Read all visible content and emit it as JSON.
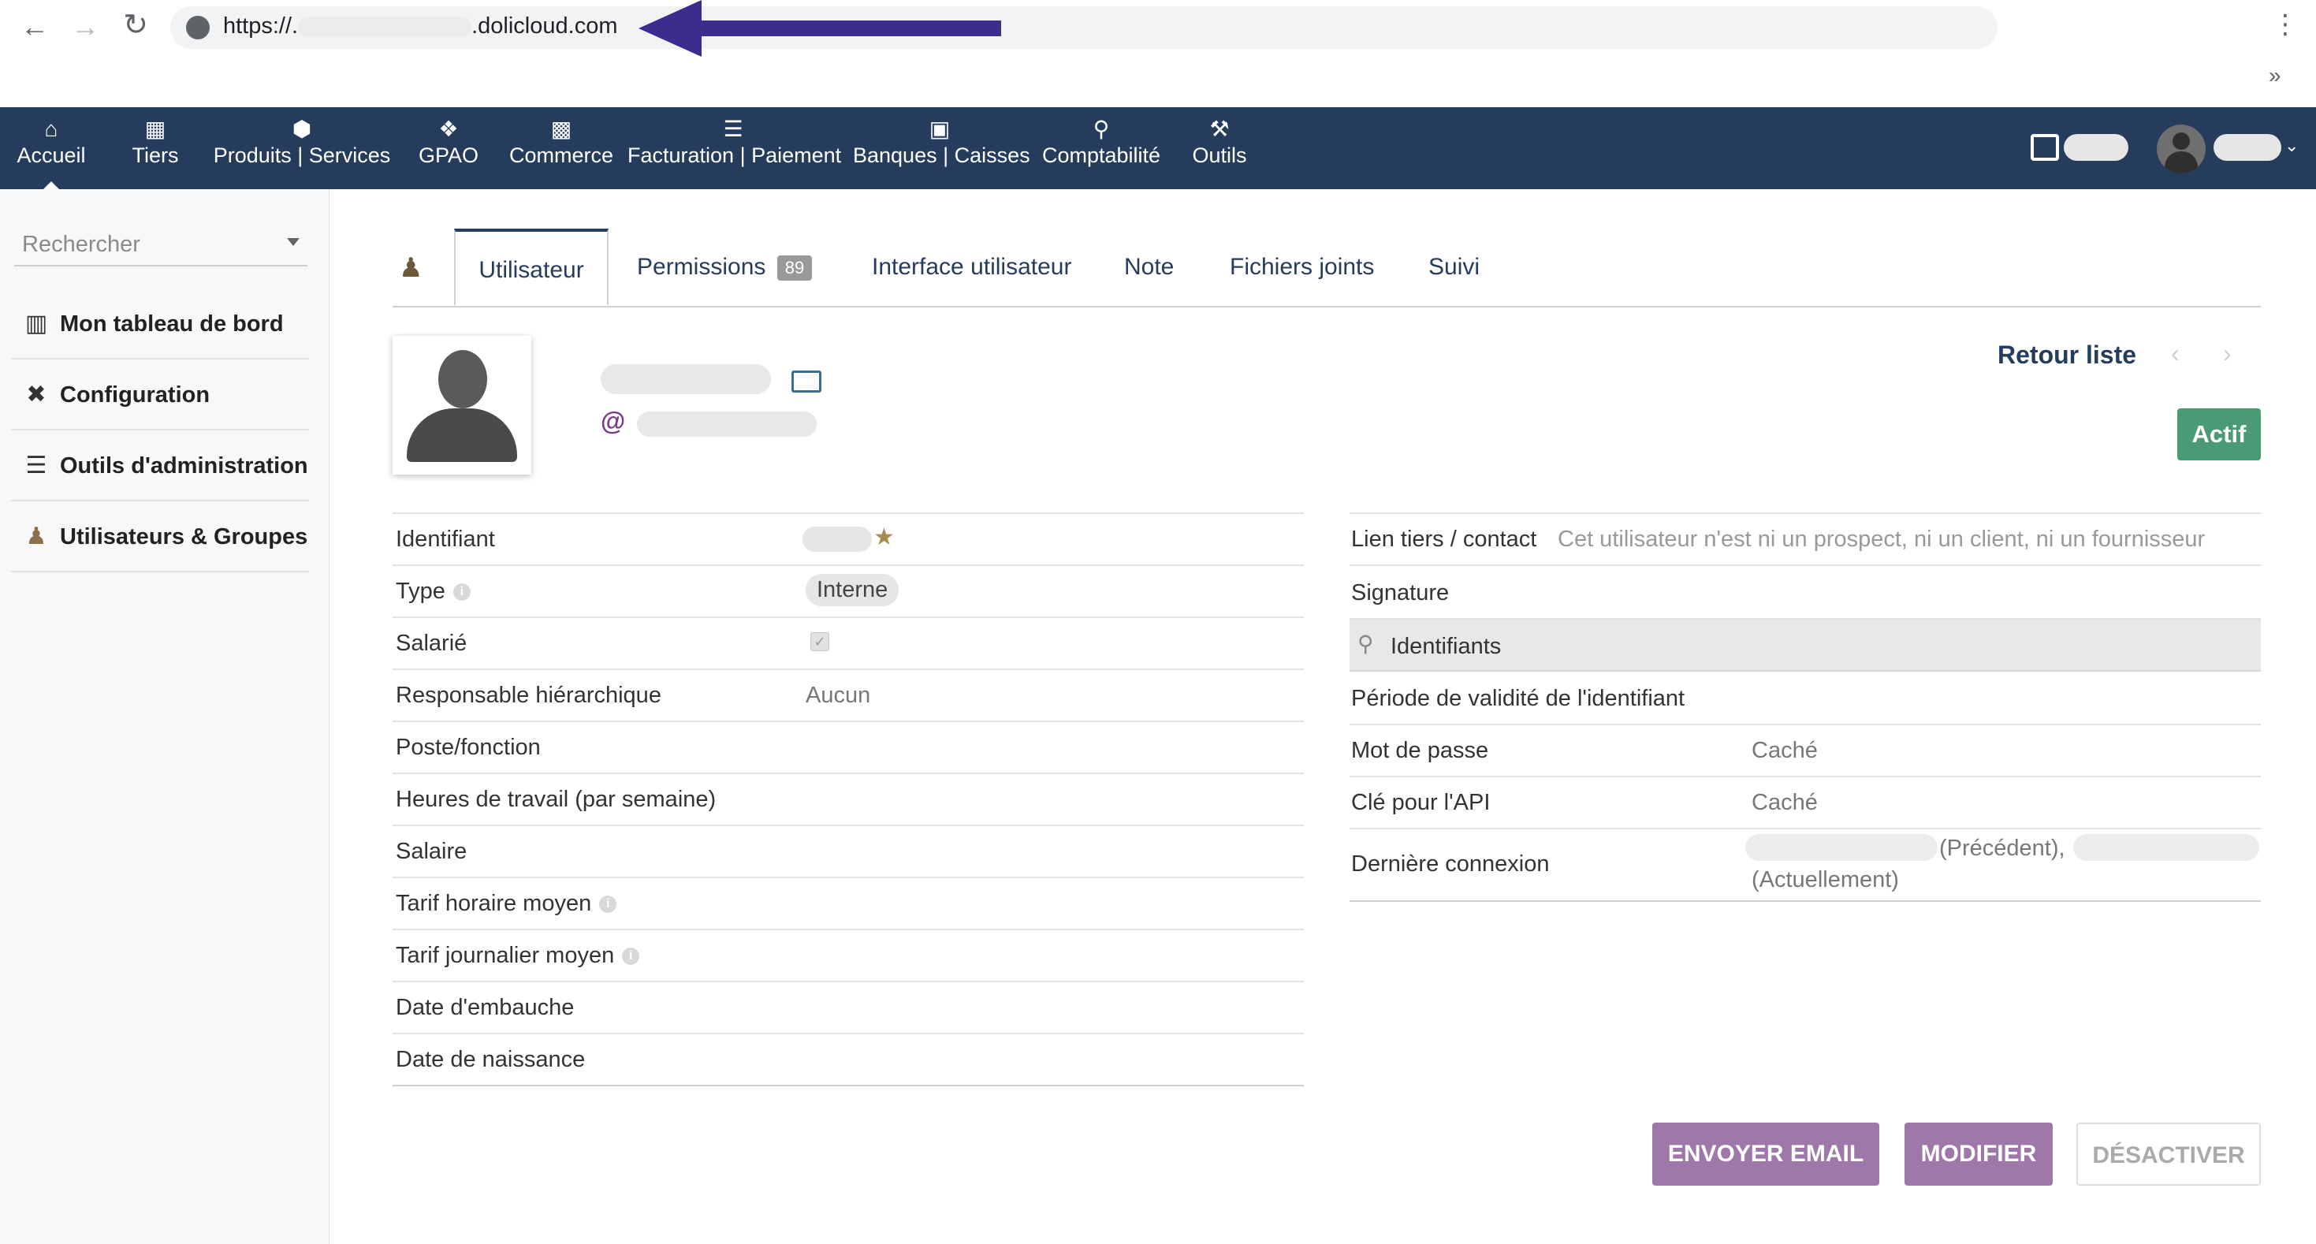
{
  "browser": {
    "url_prefix": "https://.",
    "url_suffix": ".dolicloud.com",
    "overflow_label": "»"
  },
  "topmenu": [
    {
      "label": "Accueil",
      "icon": "home-icon"
    },
    {
      "label": "Tiers",
      "icon": "building-icon"
    },
    {
      "label": "Produits | Services",
      "icon": "cube-icon"
    },
    {
      "label": "GPAO",
      "icon": "cubes-icon"
    },
    {
      "label": "Commerce",
      "icon": "briefcase-icon"
    },
    {
      "label": "Facturation | Paiement",
      "icon": "coins-icon"
    },
    {
      "label": "Banques | Caisses",
      "icon": "bank-icon"
    },
    {
      "label": "Comptabilité",
      "icon": "search-dollar-icon"
    },
    {
      "label": "Outils",
      "icon": "wrench-icon"
    }
  ],
  "sidebar": {
    "search_placeholder": "Rechercher",
    "items": [
      {
        "label": "Mon tableau de bord",
        "icon": "chart-bar-icon"
      },
      {
        "label": "Configuration",
        "icon": "tools-icon"
      },
      {
        "label": "Outils d'administration",
        "icon": "server-icon"
      },
      {
        "label": "Utilisateurs & Groupes",
        "icon": "user-icon"
      }
    ]
  },
  "tabs": [
    {
      "label": "Utilisateur",
      "active": true
    },
    {
      "label": "Permissions",
      "badge": "89"
    },
    {
      "label": "Interface utilisateur"
    },
    {
      "label": "Note"
    },
    {
      "label": "Fichiers joints"
    },
    {
      "label": "Suivi"
    }
  ],
  "header": {
    "back_link": "Retour liste",
    "status": "Actif",
    "email_icon": "@"
  },
  "left_fields": [
    {
      "label": "Identifiant",
      "value": ""
    },
    {
      "label": "Type",
      "value": "Interne",
      "info": true
    },
    {
      "label": "Salarié",
      "value": ""
    },
    {
      "label": "Responsable hiérarchique",
      "value": "Aucun"
    },
    {
      "label": "Poste/fonction",
      "value": ""
    },
    {
      "label": "Heures de travail (par semaine)",
      "value": ""
    },
    {
      "label": "Salaire",
      "value": ""
    },
    {
      "label": "Tarif horaire moyen",
      "value": "",
      "info": true
    },
    {
      "label": "Tarif journalier moyen",
      "value": "",
      "info": true
    },
    {
      "label": "Date d'embauche",
      "value": ""
    },
    {
      "label": "Date de naissance",
      "value": ""
    }
  ],
  "right_fields": {
    "lien_label": "Lien tiers / contact",
    "lien_value": "Cet utilisateur n'est ni un prospect, ni un client, ni un fournisseur",
    "signature_label": "Signature",
    "section_title": "Identifiants",
    "validity_label": "Période de validité de l'identifiant",
    "password_label": "Mot de passe",
    "password_value": "Caché",
    "api_label": "Clé pour l'API",
    "api_value": "Caché",
    "last_login_label": "Dernière connexion",
    "last_login_prev": "(Précédent),",
    "last_login_current": "(Actuellement)"
  },
  "actions": {
    "email": "ENVOYER EMAIL",
    "modify": "MODIFIER",
    "deactivate": "DÉSACTIVER"
  },
  "colors": {
    "topbar": "#263c5c",
    "active_badge": "#4a9a73",
    "action_button": "#9d78a8",
    "arrow": "#3d2c8e"
  }
}
